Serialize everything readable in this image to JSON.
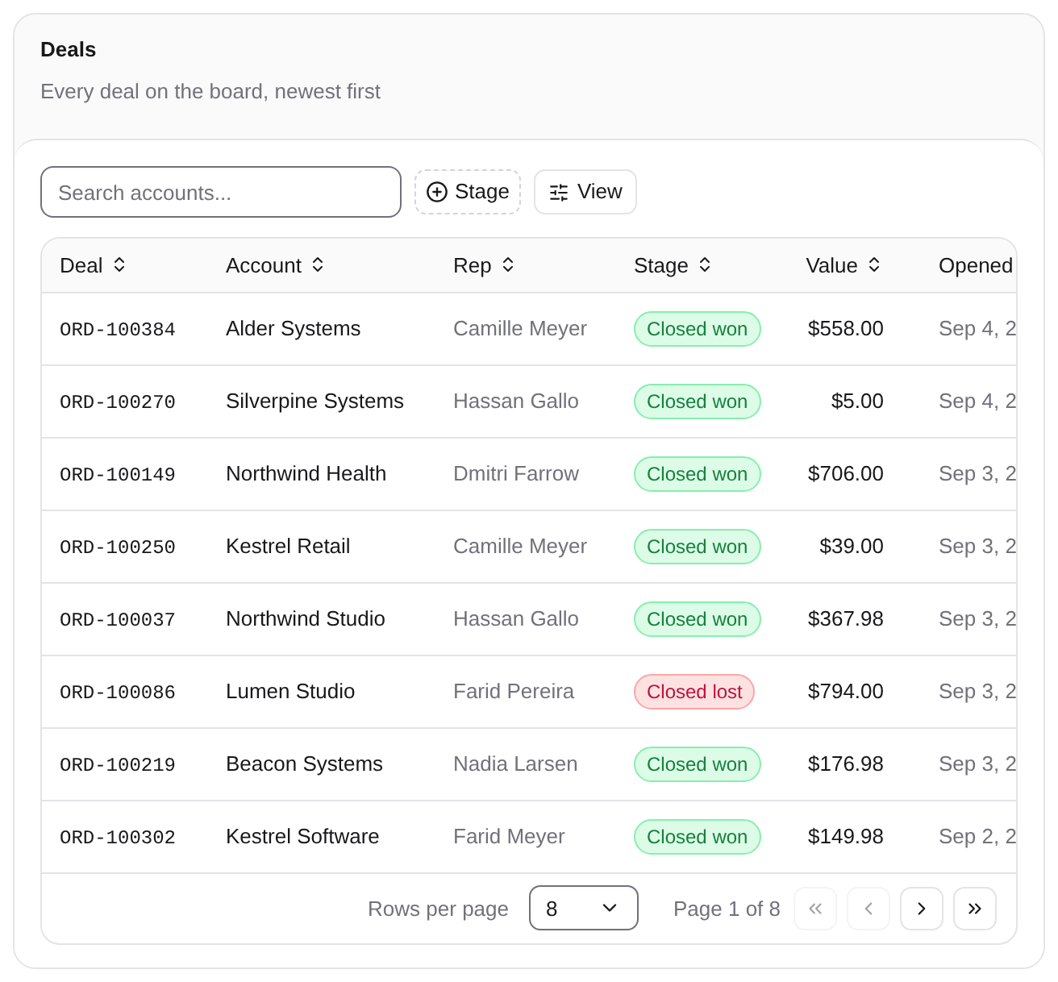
{
  "card": {
    "title": "Deals",
    "description": "Every deal on the board, newest first"
  },
  "toolbar": {
    "search": {
      "placeholder": "Search accounts..."
    },
    "filter_button": "Stage",
    "view_button": "View"
  },
  "table": {
    "columns": [
      "Deal",
      "Account",
      "Rep",
      "Stage",
      "Value",
      "Opened"
    ],
    "rows": [
      {
        "deal": "ORD-100384",
        "account": "Alder Systems",
        "rep": "Camille Meyer",
        "stage": {
          "label": "Closed won",
          "kind": "won"
        },
        "value": "$558.00",
        "opened": "Sep 4, 2"
      },
      {
        "deal": "ORD-100270",
        "account": "Silverpine Systems",
        "rep": "Hassan Gallo",
        "stage": {
          "label": "Closed won",
          "kind": "won"
        },
        "value": "$5.00",
        "opened": "Sep 4, 2"
      },
      {
        "deal": "ORD-100149",
        "account": "Northwind Health",
        "rep": "Dmitri Farrow",
        "stage": {
          "label": "Closed won",
          "kind": "won"
        },
        "value": "$706.00",
        "opened": "Sep 3, 2"
      },
      {
        "deal": "ORD-100250",
        "account": "Kestrel Retail",
        "rep": "Camille Meyer",
        "stage": {
          "label": "Closed won",
          "kind": "won"
        },
        "value": "$39.00",
        "opened": "Sep 3, 2"
      },
      {
        "deal": "ORD-100037",
        "account": "Northwind Studio",
        "rep": "Hassan Gallo",
        "stage": {
          "label": "Closed won",
          "kind": "won"
        },
        "value": "$367.98",
        "opened": "Sep 3, 2"
      },
      {
        "deal": "ORD-100086",
        "account": "Lumen Studio",
        "rep": "Farid Pereira",
        "stage": {
          "label": "Closed lost",
          "kind": "lost"
        },
        "value": "$794.00",
        "opened": "Sep 3, 2"
      },
      {
        "deal": "ORD-100219",
        "account": "Beacon Systems",
        "rep": "Nadia Larsen",
        "stage": {
          "label": "Closed won",
          "kind": "won"
        },
        "value": "$176.98",
        "opened": "Sep 3, 2"
      },
      {
        "deal": "ORD-100302",
        "account": "Kestrel Software",
        "rep": "Farid Meyer",
        "stage": {
          "label": "Closed won",
          "kind": "won"
        },
        "value": "$149.98",
        "opened": "Sep 2, 2"
      }
    ]
  },
  "pagination": {
    "rows_per_page_label": "Rows per page",
    "rows_per_page": "8",
    "page_label": "Page 1 of 8",
    "buttons": [
      {
        "kind": "first",
        "disabled": true
      },
      {
        "kind": "prev",
        "disabled": true
      },
      {
        "kind": "next",
        "disabled": false
      },
      {
        "kind": "last",
        "disabled": false
      }
    ]
  }
}
